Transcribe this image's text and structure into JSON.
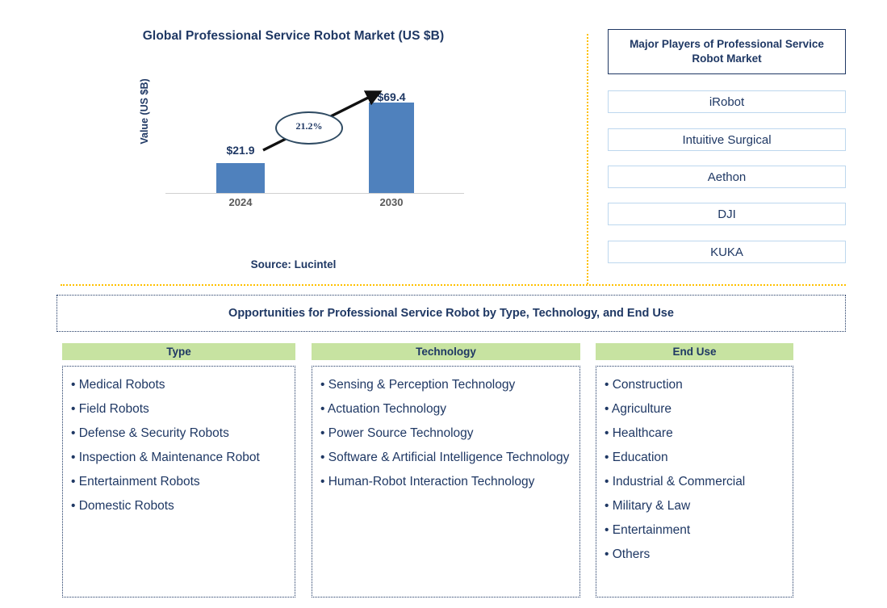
{
  "chart_data": {
    "type": "bar",
    "title": "Global Professional Service Robot Market (US $B)",
    "ylabel": "Value (US $B)",
    "xlabel": "",
    "categories": [
      "2024",
      "2030"
    ],
    "values": [
      21.9,
      69.4
    ],
    "value_labels": [
      "$21.9",
      "$69.4"
    ],
    "annotation": "21.2%",
    "annotation_meaning": "CAGR 2024-2030",
    "ylim": [
      0,
      80
    ],
    "grid": false,
    "legend": "none",
    "bar_color": "#4F81BD",
    "source": "Source: Lucintel"
  },
  "chart_panel": {
    "title": "Global Professional Service Robot Market (US $B)",
    "y_axis_label": "Value (US $B)",
    "bars": [
      {
        "category": "2024",
        "value": 21.9,
        "label": "$21.9"
      },
      {
        "category": "2030",
        "value": 69.4,
        "label": "$69.4"
      }
    ],
    "cagr_label": "21.2%",
    "source": "Source: Lucintel"
  },
  "players_panel": {
    "title": "Major Players of Professional Service Robot Market",
    "items": [
      {
        "name": "iRobot"
      },
      {
        "name": "Intuitive Surgical"
      },
      {
        "name": "Aethon"
      },
      {
        "name": "DJI"
      },
      {
        "name": "KUKA"
      }
    ]
  },
  "opportunities": {
    "title": "Opportunities for Professional Service Robot by Type, Technology, and End Use",
    "columns": [
      {
        "header": "Type",
        "items": [
          "Medical Robots",
          "Field Robots",
          "Defense & Security Robots",
          "Inspection & Maintenance Robot",
          "Entertainment Robots",
          "Domestic Robots"
        ]
      },
      {
        "header": "Technology",
        "items": [
          "Sensing & Perception Technology",
          "Actuation Technology",
          "Power Source Technology",
          "Software & Artificial Intelligence Technology",
          "Human-Robot Interaction Technology"
        ]
      },
      {
        "header": "End Use",
        "items": [
          "Construction",
          "Agriculture",
          "Healthcare",
          "Education",
          "Industrial & Commercial",
          "Military & Law",
          "Entertainment",
          "Others"
        ]
      }
    ]
  },
  "colors": {
    "bar_blue": "#4F81BD",
    "header_green": "#C7E3A1",
    "text_navy": "#1F3864",
    "divider_orange": "#FFC000",
    "player_border": "#BDD7EE",
    "axis_gray": "#595959"
  }
}
